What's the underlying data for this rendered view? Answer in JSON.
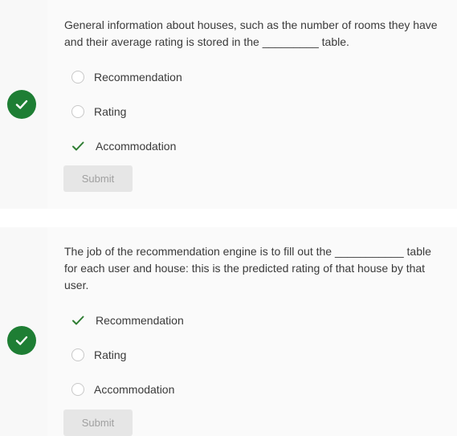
{
  "questions": [
    {
      "text": "General information about houses, such as the number of rooms they have and their average rating is stored in the _________ table.",
      "options": [
        {
          "label": "Recommendation",
          "state": "unselected"
        },
        {
          "label": "Rating",
          "state": "unselected"
        },
        {
          "label": "Accommodation",
          "state": "correct"
        }
      ],
      "submit_label": "Submit",
      "status": "correct"
    },
    {
      "text": "The job of the recommendation engine is to fill out the ___________ table for each user and house: this is the predicted rating of that house by that user.",
      "options": [
        {
          "label": "Recommendation",
          "state": "correct"
        },
        {
          "label": "Rating",
          "state": "unselected"
        },
        {
          "label": "Accommodation",
          "state": "unselected"
        }
      ],
      "submit_label": "Submit",
      "status": "correct"
    }
  ],
  "colors": {
    "success": "#1e7e34",
    "check": "#2e7d32",
    "text": "#3a3a3a",
    "disabled_text": "#a0a0a0",
    "disabled_bg": "#e6e6e6"
  },
  "icons": {
    "status": "check-circle-icon",
    "correct_answer": "check-icon",
    "unselected_answer": "radio-empty-icon"
  }
}
